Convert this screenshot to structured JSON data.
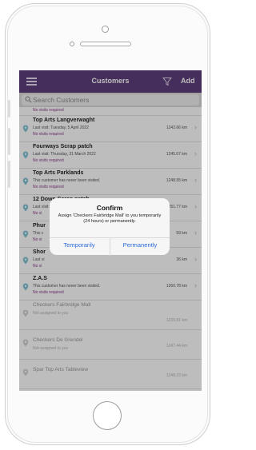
{
  "nav": {
    "title": "Customers",
    "add_label": "Add",
    "menu_icon": "hamburger-menu-icon",
    "filter_icon": "filter-icon"
  },
  "search": {
    "placeholder": "Search Customers",
    "icon": "search-icon"
  },
  "customers": [
    {
      "name": "",
      "subtitle": "",
      "status": "No visits required",
      "distance": ""
    },
    {
      "name": "Top Arts Langverwaght",
      "subtitle": "Last visit: Tuesday, 5 April 2022",
      "status": "No visits required",
      "distance": "1242.66 km"
    },
    {
      "name": "Fourways Scrap patch",
      "subtitle": "Last visit: Thursday, 31 March 2022",
      "status": "No visits required",
      "distance": "1245.07 km"
    },
    {
      "name": "Top Arts Parklands",
      "subtitle": "This customer has never been visited.",
      "status": "No visits required",
      "distance": "1248.55 km"
    },
    {
      "name": "12 Down Scrap patch",
      "subtitle": "Last visit: Saturday, 2 April 2022",
      "status": "No vi",
      "distance": "1251.77 km"
    },
    {
      "name": "Phur",
      "subtitle": "This c",
      "status": "No vi",
      "distance": "59 km"
    },
    {
      "name": "Shor",
      "subtitle": "Last vi",
      "status": "No vi",
      "distance": "36 km"
    },
    {
      "name": "Z.A.S",
      "subtitle": "This customer has never been visited.",
      "status": "No visits required",
      "distance": "1260.78 km"
    },
    {
      "name": "Checkers Fairbridge Mall",
      "subtitle": "",
      "status": "Not assigned to you",
      "distance": "1239.81 km"
    },
    {
      "name": "Checkers De Grendel",
      "subtitle": "",
      "status": "Not assigned to you",
      "distance": "1247.44 km"
    },
    {
      "name": "Spar Top Arts Tableview",
      "subtitle": "",
      "status": "",
      "distance": "1248.23 km"
    }
  ],
  "dialog": {
    "title": "Confirm",
    "message": "Assign 'Checkers Fairbridge Mall' to you temporarily (24 hours) or permanently.",
    "temporarily_label": "Temporarily",
    "permanently_label": "Permanently"
  },
  "colors": {
    "brand": "#5e3e7c",
    "status": "#8d3a8d",
    "link": "#2a6bd8",
    "pin": "#7fc4d6"
  }
}
